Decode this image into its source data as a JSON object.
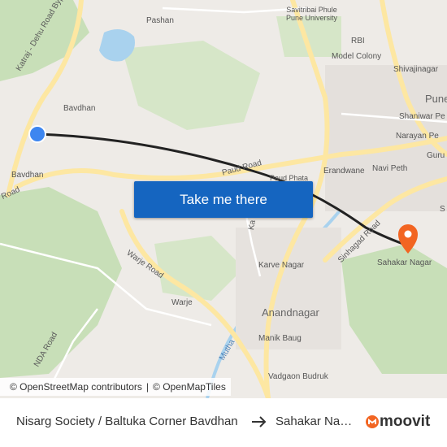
{
  "map": {
    "labels": {
      "pashan": "Pashan",
      "university": "Savitribai Phule\nPune University",
      "rbi": "RBI",
      "model_colony": "Model Colony",
      "shivajinagar": "Shivajinagar",
      "pune": "Pune",
      "shaniwar": "Shaniwar Pe",
      "narayan": "Narayan Pe",
      "guru": "Guru",
      "navi_peth": "Navi Peth",
      "s_edge": "S",
      "bavdhan_top": "Bavdhan",
      "bavdhan": "Bavdhan",
      "bypass": "Katraj - Dehu Road Bypass",
      "road_left": "Road",
      "paud_road": "Paud Road",
      "paud_phata": "Paud Phata",
      "erandwane": "Erandwane",
      "sinhagad_road": "Sinhagad Road",
      "karve_nagar": "Karve Nagar",
      "sahakar_nagar": "Sahakar Nagar",
      "warje_road": "Warje Road",
      "warje": "Warje",
      "anandnagar": "Anandnagar",
      "manik_baug": "Manik Baug",
      "mutha": "Mutha",
      "nda_road": "NDA Road",
      "vadgaon": "Vadgaon Budruk",
      "ka": "Ka"
    },
    "colors": {
      "land": "#eeebe7",
      "park": "#c8dfb8",
      "water": "#a9d2ee",
      "road_major": "#fde7a2",
      "route": "#222222",
      "origin_marker": "#3d86f0",
      "dest_marker": "#f26522"
    },
    "origin_marker_icon": "blue-dot-icon",
    "dest_marker_icon": "map-pin-icon"
  },
  "cta": {
    "label": "Take me there"
  },
  "attribution": {
    "osm_contrib": "© OpenStreetMap contributors",
    "separator": "|",
    "osm_tiles": "© OpenMapTiles"
  },
  "footer": {
    "origin": "Nisarg Society / Baltuka Corner Bavdhan",
    "arrow_icon": "arrow-right-icon",
    "destination": "Sahakar Nagar",
    "brand": "moovit",
    "brand_icon": "moovit-logo-icon",
    "brand_color": "#f26522"
  }
}
